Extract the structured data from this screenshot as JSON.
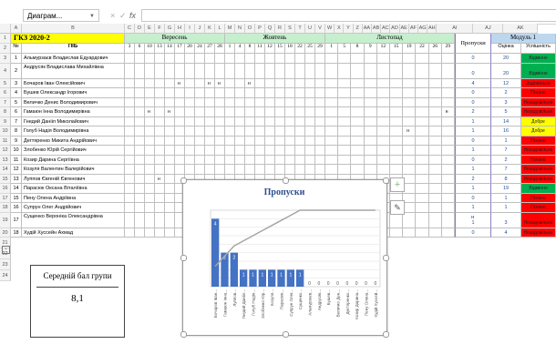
{
  "name_box": "Диаграм...",
  "formula_buttons": [
    "×",
    "✓",
    "fx"
  ],
  "col_headers": [
    "A",
    "B",
    "C",
    "D",
    "E",
    "F",
    "G",
    "H",
    "I",
    "J",
    "K",
    "L",
    "M",
    "N",
    "O",
    "P",
    "Q",
    "R",
    "S",
    "T",
    "U",
    "V",
    "W",
    "X",
    "Y",
    "Z",
    "AA",
    "AB",
    "AC",
    "AD",
    "AE",
    "AF",
    "AG",
    "AH",
    "AI",
    "AJ",
    "AK"
  ],
  "title_row": {
    "group": "ГКЗ 2020-2",
    "month1": "Вересень",
    "month2": "Жовтень",
    "month3": "Листопад",
    "absences": "Пропуски",
    "module": "Модуль 1"
  },
  "header_row": {
    "num": "№",
    "name": "ПІБ",
    "days1": [
      "3",
      "6",
      "10",
      "13",
      "14",
      "17",
      "20",
      "24",
      "27",
      "28"
    ],
    "days2": [
      "1",
      "4",
      "8",
      "11",
      "12",
      "15",
      "18",
      "22",
      "25",
      "29"
    ],
    "days3": [
      "1",
      "5",
      "8",
      "9",
      "12",
      "15",
      "19",
      "22",
      "26",
      "29"
    ],
    "grade": "Оцінка",
    "progress": "Успішність"
  },
  "students": [
    {
      "row": "3",
      "num": "1",
      "name": "Альмурзаєв Владислав Едуардович",
      "abs": "0",
      "grade": "20",
      "status": "Відмінно",
      "color": "#00b050"
    },
    {
      "row": "4",
      "num": "2",
      "name": "Андрусяк Владислава Михайлівна",
      "abs": "0",
      "grade": "20",
      "status": "Відмінно",
      "color": "#00b050"
    },
    {
      "row": "5",
      "num": "3",
      "name": "Бочаров Іван Олексійович",
      "abs": "4",
      "grade": "12",
      "status": "Задовільно",
      "color": "#ff0000"
    },
    {
      "row": "6",
      "num": "4",
      "name": "Бушев Олександр Ігорович",
      "abs": "0",
      "grade": "2",
      "status": "Погано",
      "color": "#ff0000"
    },
    {
      "row": "7",
      "num": "5",
      "name": "Величко Денис Володимирович",
      "abs": "0",
      "grade": "3",
      "status": "Незадовільно",
      "color": "#ff0000"
    },
    {
      "row": "8",
      "num": "6",
      "name": "Гамаюн Інна Володимирівна",
      "abs": "2",
      "grade": "5",
      "status": "Незадовільно",
      "color": "#ff0000"
    },
    {
      "row": "9",
      "num": "7",
      "name": "Гнедий Данііл Миколайович",
      "abs": "1",
      "grade": "14",
      "status": "Добре",
      "color": "#ffff00"
    },
    {
      "row": "10",
      "num": "8",
      "name": "Голуб Надія Володимирівна",
      "abs": "1",
      "grade": "16",
      "status": "Добре",
      "color": "#ffff00"
    },
    {
      "row": "11",
      "num": "9",
      "name": "Дегтяренко Микита Андрійович",
      "abs": "0",
      "grade": "1",
      "status": "Погано",
      "color": "#ff0000"
    },
    {
      "row": "12",
      "num": "10",
      "name": "Злобенко Юрій Сергійович",
      "abs": "1",
      "grade": "7",
      "status": "Незадовільно",
      "color": "#ff0000"
    },
    {
      "row": "13",
      "num": "11",
      "name": "Козир Дарина Сергіївна",
      "abs": "0",
      "grade": "2",
      "status": "Погано",
      "color": "#ff0000"
    },
    {
      "row": "14",
      "num": "12",
      "name": "Козуля Валентин Валерійович",
      "abs": "1",
      "grade": "7",
      "status": "Незадовільно",
      "color": "#ff0000"
    },
    {
      "row": "15",
      "num": "13",
      "name": "Луппов Євгеній Євгенович",
      "abs": "2",
      "grade": "8",
      "status": "Незадовільно",
      "color": "#ff0000"
    },
    {
      "row": "16",
      "num": "14",
      "name": "Парасюк Оксана Віталіївна",
      "abs": "1",
      "grade": "19",
      "status": "Відмінно",
      "color": "#00b050"
    },
    {
      "row": "17",
      "num": "15",
      "name": "Пену Олена Андріївна",
      "abs": "0",
      "grade": "1",
      "status": "Погано",
      "color": "#ff0000"
    },
    {
      "row": "18",
      "num": "16",
      "name": "Супрун Олег Андрійович",
      "abs": "1",
      "grade": "1",
      "status": "Погано",
      "color": "#ff0000"
    },
    {
      "row": "19",
      "num": "17",
      "name": "Сущенко Вероніка Олександрівна",
      "abs": "1",
      "grade": "3",
      "status": "Незадовільно",
      "color": "#ff0000"
    },
    {
      "row": "20",
      "num": "18",
      "name": "Худій Хуссейн Ахмад",
      "abs": "0",
      "grade": "4",
      "status": "Незадовільно",
      "color": "#ff0000"
    }
  ],
  "marks": [
    {
      "row": 5,
      "cols": [
        5,
        8,
        9,
        12
      ]
    },
    {
      "row": 8,
      "cols": [
        2,
        4,
        29
      ]
    },
    {
      "row": 10,
      "cols": [
        26
      ]
    },
    {
      "row": 15,
      "cols": [
        3
      ]
    },
    {
      "row": 19,
      "cols": [
        31
      ]
    }
  ],
  "extra_rows": [
    "21",
    "22",
    "23",
    "24"
  ],
  "average": {
    "title": "Середній бал групи",
    "value": "8,1"
  },
  "chart_data": {
    "type": "bar",
    "title": "Пропуски",
    "categories": [
      "Бочаров Іван...",
      "Гамаюн Інна...",
      "Луппов...",
      "Гнедий Данііл...",
      "Голуб Надія...",
      "Злобенко Юр...",
      "Козуля...",
      "Парасюк...",
      "Супрун Олег...",
      "Сущенко...",
      "Альмурзаєв...",
      "Андрусяк...",
      "Бушев...",
      "Величко Ден...",
      "Дегтяренко...",
      "Козир Дарина...",
      "Пену Олена...",
      "Худій Хуссей..."
    ],
    "values": [
      4,
      2,
      2,
      1,
      1,
      1,
      1,
      1,
      1,
      1,
      0,
      0,
      0,
      0,
      0,
      0,
      0,
      0
    ],
    "bar_color": "#4472c4",
    "line_color": "#a5a5a5"
  }
}
